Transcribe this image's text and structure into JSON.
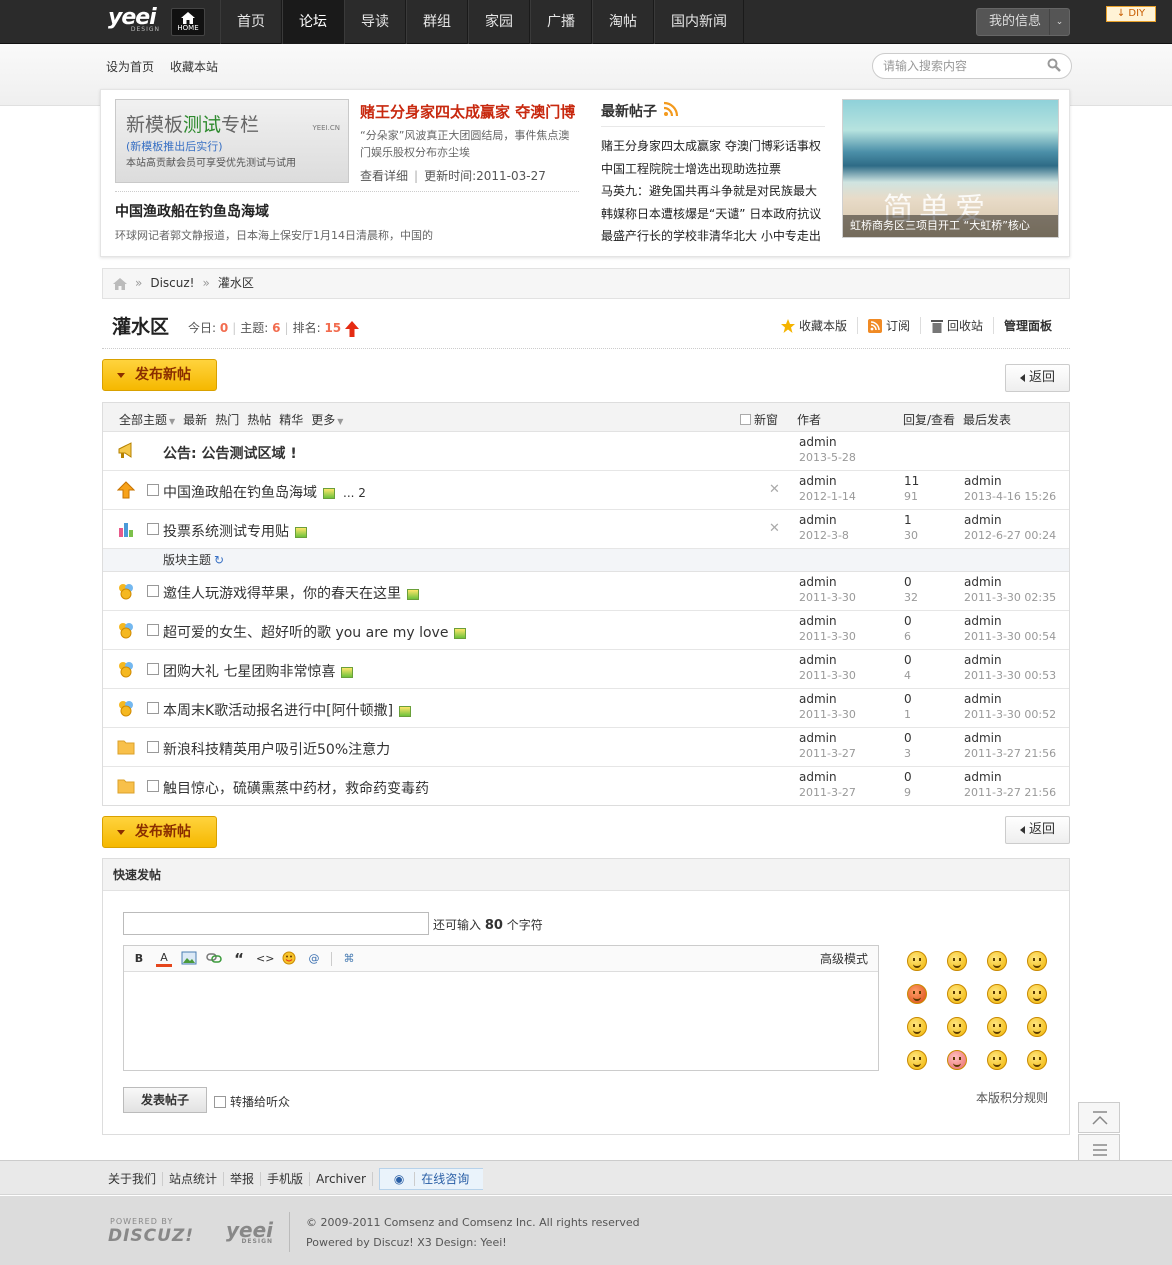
{
  "topnav": {
    "logo": "yeei",
    "logo_sub": "DESIGN",
    "home_label": "HOME",
    "menu": [
      "首页",
      "论坛",
      "导读",
      "群组",
      "家园",
      "广播",
      "淘帖",
      "国内新闻"
    ],
    "active_index": 1,
    "my_info": "我的信息",
    "diy": "DIY"
  },
  "subbar": {
    "set_home": "设为首页",
    "bookmark": "收藏本站",
    "search_placeholder": "请输入搜索内容"
  },
  "feature": {
    "banner": {
      "title_a": "新模板",
      "title_b": "测试",
      "title_c": "专栏",
      "url": "YEEI.CN",
      "subtitle": "(新模板推出后实行)",
      "desc": "本站高贡献会员可享受优先测试与试用"
    },
    "headline": {
      "title": "赌王分身家四太成赢家 夺澳门博",
      "desc": "“分朵家”风波真正大团圆结局，事件焦点澳门娱乐股权分布亦尘埃",
      "more": "查看详细",
      "updated": "更新时间:2011-03-27"
    },
    "sub": {
      "title": "中国渔政船在钓鱼岛海域",
      "desc": "环球网记者郭文静报道，日本海上保安厅1月14日清晨称，中国的"
    },
    "latest": {
      "heading": "最新帖子",
      "items": [
        "赌王分身家四太成赢家 夺澳门博彩话事权",
        "中国工程院院士增选出现助选拉票",
        "马英九：避免国共再斗争就是对民族最大",
        "韩媒称日本遭核爆是“天谴” 日本政府抗议",
        "最盛产行长的学校非清华北大 小中专走出"
      ]
    },
    "photo": {
      "overlay": "简单爱",
      "caption": "虹桥商务区三项目开工 “大虹桥”核心"
    }
  },
  "breadcrumb": {
    "items": [
      "Discuz!",
      "灌水区"
    ]
  },
  "forum": {
    "name": "灌水区",
    "today_label": "今日:",
    "today": "0",
    "threads_label": "主题:",
    "threads": "6",
    "rank_label": "排名:",
    "rank": "15",
    "actions": {
      "favorite": "收藏本版",
      "subscribe": "订阅",
      "recycle": "回收站",
      "admin": "管理面板"
    }
  },
  "buttons": {
    "new_post": "发布新帖",
    "back": "返回"
  },
  "thread_list": {
    "filters": [
      "全部主题",
      "最新",
      "热门",
      "热帖",
      "精华",
      "更多"
    ],
    "new_window": "新窗",
    "col_author": "作者",
    "col_replies": "回复/查看",
    "col_last": "最后发表",
    "announcement": {
      "subject": "公告: 公告测试区域 !",
      "author": "admin",
      "date": "2013-5-28"
    },
    "sticky": [
      {
        "subject": "中国渔政船在钓鱼岛海域",
        "pages": "... 2",
        "author": "admin",
        "date": "2012-1-14",
        "replies": "11",
        "views": "91",
        "last_user": "admin",
        "last_time": "2013-4-16 15:26"
      },
      {
        "subject": "投票系统测试专用贴",
        "pages": "",
        "author": "admin",
        "date": "2012-3-8",
        "replies": "1",
        "views": "30",
        "last_user": "admin",
        "last_time": "2012-6-27 00:24"
      }
    ],
    "section_label": "版块主题",
    "threads": [
      {
        "subject": "邀佳人玩游戏得苹果，你的春天在这里",
        "author": "admin",
        "date": "2011-3-30",
        "replies": "0",
        "views": "32",
        "last_user": "admin",
        "last_time": "2011-3-30 02:35"
      },
      {
        "subject": "超可爱的女生、超好听的歌 you are my love",
        "author": "admin",
        "date": "2011-3-30",
        "replies": "0",
        "views": "6",
        "last_user": "admin",
        "last_time": "2011-3-30 00:54"
      },
      {
        "subject": "团购大礼 七星团购非常惊喜",
        "author": "admin",
        "date": "2011-3-30",
        "replies": "0",
        "views": "4",
        "last_user": "admin",
        "last_time": "2011-3-30 00:53"
      },
      {
        "subject": "本周末K歌活动报名进行中[阿什顿撒]",
        "author": "admin",
        "date": "2011-3-30",
        "replies": "0",
        "views": "1",
        "last_user": "admin",
        "last_time": "2011-3-30 00:52"
      },
      {
        "subject": "新浪科技精英用户吸引近50%注意力",
        "author": "admin",
        "date": "2011-3-27",
        "replies": "0",
        "views": "3",
        "last_user": "admin",
        "last_time": "2011-3-27 21:56"
      },
      {
        "subject": "触目惊心，硫磺熏蒸中药材，救命药变毒药",
        "author": "admin",
        "date": "2011-3-27",
        "replies": "0",
        "views": "9",
        "last_user": "admin",
        "last_time": "2011-3-27 21:56"
      }
    ]
  },
  "quick_post": {
    "heading": "快速发帖",
    "remain_prefix": "还可输入",
    "remain_count": "80",
    "remain_suffix": "个字符",
    "advanced": "高级模式",
    "submit": "发表帖子",
    "broadcast": "转播给听众",
    "rules": "本版积分规则"
  },
  "footer": {
    "links": [
      "关于我们",
      "站点统计",
      "举报",
      "手机版",
      "Archiver"
    ],
    "online": "在线咨询",
    "powered_by": "POWERED BY",
    "discuz": "DISCUZ!",
    "copyright": "© 2009-2011 Comsenz  and Comsenz Inc.  All rights reserved",
    "credit": "Powered by Discuz!  X3 Design: Yeei!"
  },
  "colors": {
    "accent_red": "#c8290f",
    "stat_orange": "#f26c4f",
    "button_yellow": "#f5b800",
    "nav_dark": "#2b2b2b"
  }
}
